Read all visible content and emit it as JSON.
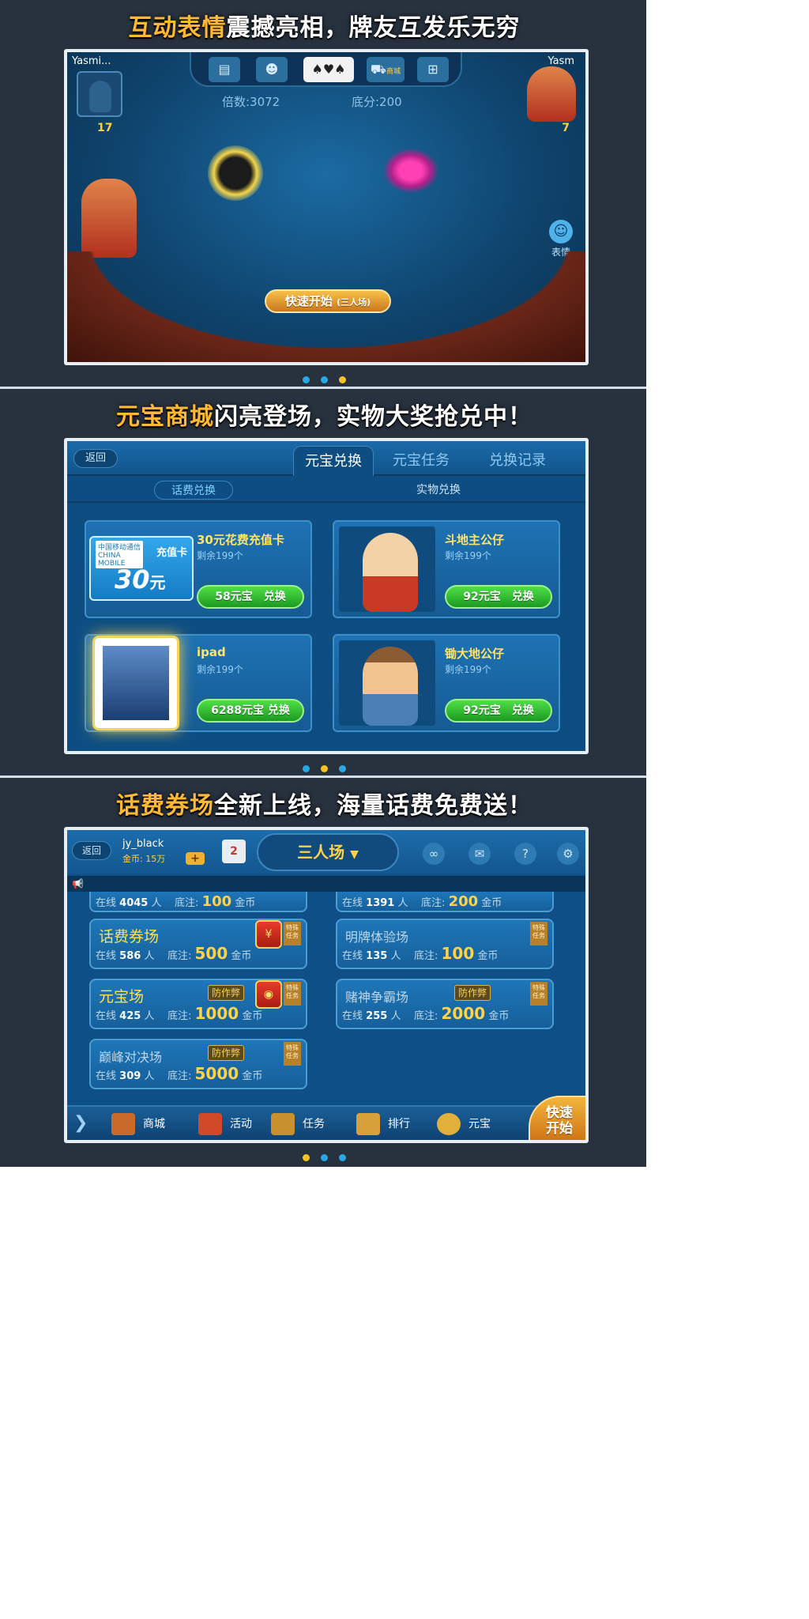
{
  "panel1": {
    "banner_highlight": "互动表情",
    "banner_rest": "震撼亮相，牌友互发乐无穷",
    "left_player": "Yasmi...",
    "right_player": "Yasm",
    "left_count": "17",
    "right_count": "7",
    "multiplier": "倍数:3072",
    "base_score": "底分:200",
    "emote_label": "表情",
    "mall_badge": "商城",
    "quick_start": "快速开始",
    "quick_start_mode": "(三人场)",
    "icons": [
      "box-icon",
      "robot-icon",
      "cards-icon",
      "cart-icon",
      "gift-icon"
    ],
    "page_index": 2
  },
  "panel2": {
    "banner_highlight": "元宝商城",
    "banner_rest": "闪亮登场，实物大奖抢兑中！",
    "back": "返回",
    "tabs": [
      "元宝兑换",
      "元宝任务",
      "兑换记录"
    ],
    "subtabs": [
      "话费兑换",
      "实物兑换"
    ],
    "items": [
      {
        "title": "30元花费充值卡",
        "remain": "剩余199个",
        "button": "58元宝　兑换",
        "card_brand": "中国移动通信 CHINA MOBILE",
        "card_kind": "充值卡",
        "card_amount": "30",
        "card_unit": "元"
      },
      {
        "title": "斗地主公仔",
        "remain": "剩余199个",
        "button": "92元宝　兑换"
      },
      {
        "title": "ipad",
        "remain": "剩余199个",
        "button": "6288元宝 兑换"
      },
      {
        "title": "锄大地公仔",
        "remain": "剩余199个",
        "button": "92元宝　兑换"
      }
    ],
    "page_index": 1
  },
  "panel3": {
    "banner_highlight": "话费券场",
    "banner_rest": "全新上线，海量话费免费送！",
    "back": "返回",
    "user": "jy_black",
    "coins": "金币: 15万",
    "mode": "三人场",
    "top_rows": [
      {
        "online": "4045",
        "bet": "100"
      },
      {
        "online": "1391",
        "bet": "200"
      }
    ],
    "rooms": [
      {
        "name": "话费券场",
        "online": "586",
        "bet": "500",
        "badge": "¥",
        "ribbon": "特殊任务"
      },
      {
        "name": "明牌体验场",
        "online": "135",
        "bet": "100",
        "ribbon": "特殊任务"
      },
      {
        "name": "元宝场",
        "online": "425",
        "bet": "1000",
        "tag": "防作弊",
        "ribbon": "特殊任务"
      },
      {
        "name": "赌神争霸场",
        "online": "255",
        "bet": "2000",
        "tag": "防作弊",
        "ribbon": "特殊任务"
      },
      {
        "name": "巅峰对决场",
        "online": "309",
        "bet": "5000",
        "tag": "防作弊",
        "ribbon": "特殊任务"
      }
    ],
    "labels": {
      "online": "在线",
      "people": "人",
      "bet": "底注:",
      "coin": "金币"
    },
    "bottom": [
      "商城",
      "活动",
      "任务",
      "排行",
      "元宝"
    ],
    "quick_start_line1": "快速",
    "quick_start_line2": "开始",
    "page_index": 0
  },
  "colors": {
    "accent": "#ffb833",
    "dot": "#29a8e6",
    "dot_active": "#f6c323",
    "bg": "#28323f"
  }
}
